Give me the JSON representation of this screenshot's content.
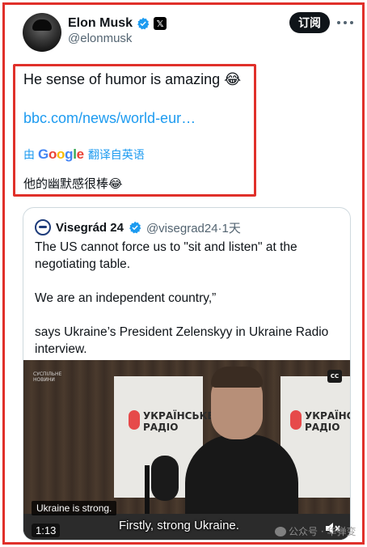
{
  "author": {
    "display_name": "Elon Musk",
    "handle": "@elonmusk",
    "x_badge": "𝕏"
  },
  "actions": {
    "subscribe_label": "订阅"
  },
  "tweet": {
    "text": "He sense of humor is amazing 😂",
    "link": "bbc.com/news/world-eur…",
    "translate_by": "由",
    "translate_source": "翻译自英语",
    "translated_text": "他的幽默感很棒😂"
  },
  "google_logo": [
    "G",
    "o",
    "o",
    "g",
    "l",
    "e"
  ],
  "quoted": {
    "name": "Visegrád 24",
    "handle_time": "@visegrad24·1天",
    "paragraphs": [
      "The US cannot force us to \"sit and listen\" at the negotiating table.",
      "We are an independent country,”",
      "says Ukraine’s President Zelenskyy in Ukraine Radio interview."
    ]
  },
  "video": {
    "channel_logo_line1": "СУСПІЛЬНЕ",
    "channel_logo_line2": "НОВИНИ",
    "cc_label": "CC",
    "brand_line1": "УКРАЇНСЬКЕ",
    "brand_line2": "РАДІО",
    "caption_small": "Ukraine is strong.",
    "caption_big": "Firstly, strong Ukraine.",
    "time": "1:13"
  },
  "watermark": {
    "text": "公众号 · 华弹变"
  },
  "colors": {
    "accent": "#1d9bf0",
    "highlight": "#e0302a",
    "verified": "#1d9bf0"
  }
}
